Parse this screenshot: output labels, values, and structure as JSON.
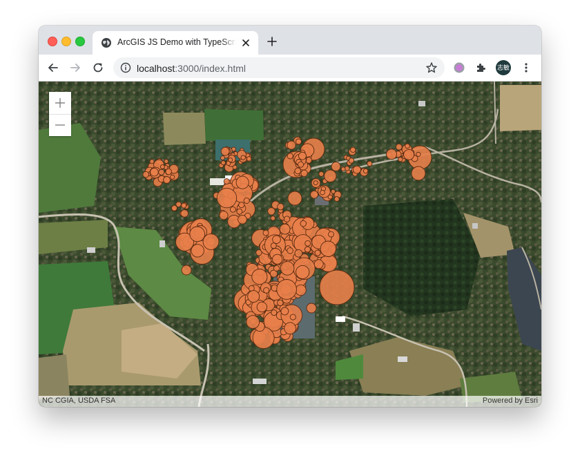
{
  "browser": {
    "tab_title": "ArcGIS JS Demo with TypeScript",
    "url_host": "localhost",
    "url_path": ":3000/index.html",
    "profile_initials": "志敏",
    "icons": [
      "globe-icon",
      "close-icon",
      "plus-icon",
      "back-arrow-icon",
      "forward-arrow-icon",
      "reload-icon",
      "info-icon",
      "star-icon",
      "extension-circle-icon",
      "puzzle-icon",
      "more-vert-icon"
    ]
  },
  "map": {
    "attribution_left": "NC CGIA, USDA FSA",
    "attribution_right": "Powered by Esri",
    "zoom_in_icon": "plus-icon",
    "zoom_out_icon": "minus-icon",
    "marker_color": "#e8804a",
    "marker_outline": "#5a2a10"
  }
}
